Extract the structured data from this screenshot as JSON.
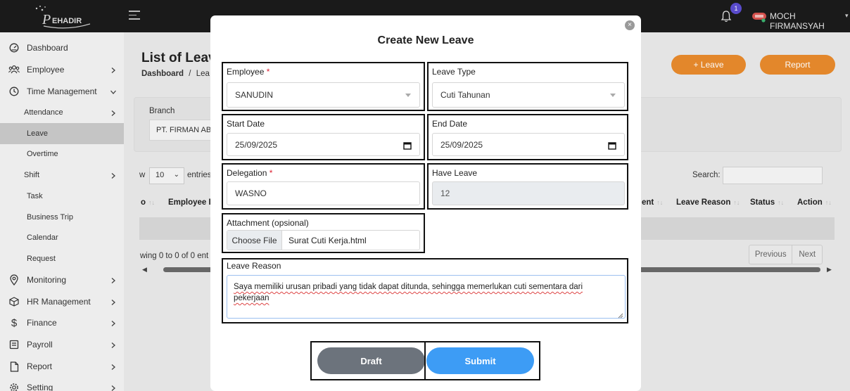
{
  "topbar": {
    "brand": "EHADIR",
    "notification_count": "1",
    "user_name": "MOCH FIRMANSYAH"
  },
  "sidebar": {
    "items": [
      {
        "label": "Dashboard",
        "icon": "dashboard-icon"
      },
      {
        "label": "Employee",
        "icon": "users-icon"
      },
      {
        "label": "Time Management",
        "icon": "clock-icon"
      },
      {
        "label": "Attendance"
      },
      {
        "label": "Leave"
      },
      {
        "label": "Overtime"
      },
      {
        "label": "Shift"
      },
      {
        "label": "Task"
      },
      {
        "label": "Business Trip"
      },
      {
        "label": "Calendar"
      },
      {
        "label": "Request"
      },
      {
        "label": "Monitoring",
        "icon": "location-icon"
      },
      {
        "label": "HR Management",
        "icon": "box-icon"
      },
      {
        "label": "Finance",
        "icon": "dollar-icon"
      },
      {
        "label": "Payroll",
        "icon": "payroll-icon"
      },
      {
        "label": "Report",
        "icon": "file-icon"
      },
      {
        "label": "Setting",
        "icon": "gear-icon"
      }
    ]
  },
  "page": {
    "title": "List of Leav",
    "breadcrumb_root": "Dashboard",
    "breadcrumb_sep": "/",
    "breadcrumb_current": "Lea",
    "add_leave_label": "+ Leave",
    "report_label": "Report",
    "branch_label": "Branch",
    "branch_value": "PT. FIRMAN AB",
    "show_label": "w",
    "entries_value": "10",
    "entries_label": "entries",
    "search_label": "Search:",
    "columns": {
      "no": "o",
      "employee": "Employee I",
      "ent": "ent",
      "leave_reason": "Leave Reason",
      "status": "Status",
      "action": "Action"
    },
    "showing": "wing 0 to 0 of 0 ent",
    "previous": "Previous",
    "next": "Next"
  },
  "modal": {
    "title": "Create New Leave",
    "employee_label": "Employee",
    "employee_value": "SANUDIN",
    "leave_type_label": "Leave Type",
    "leave_type_value": "Cuti Tahunan",
    "start_date_label": "Start Date",
    "start_date_value": "25/09/2025",
    "end_date_label": "End Date",
    "end_date_value": "25/09/2025",
    "delegation_label": "Delegation",
    "delegation_value": "WASNO",
    "have_leave_label": "Have Leave",
    "have_leave_value": "12",
    "attachment_label": "Attachment (opsional)",
    "choose_file_label": "Choose File",
    "file_name": "Surat Cuti Kerja.html",
    "leave_reason_label": "Leave Reason",
    "leave_reason_value": "Saya memiliki urusan pribadi yang tidak dapat ditunda, sehingga memerlukan cuti sementara dari pekerjaan",
    "required_mark": "*",
    "draft_label": "Draft",
    "submit_label": "Submit"
  },
  "colors": {
    "accent_orange": "#e88a2c",
    "submit_blue": "#3d9cf5",
    "draft_gray": "#6c737c",
    "topbar": "#1b1b1b"
  }
}
